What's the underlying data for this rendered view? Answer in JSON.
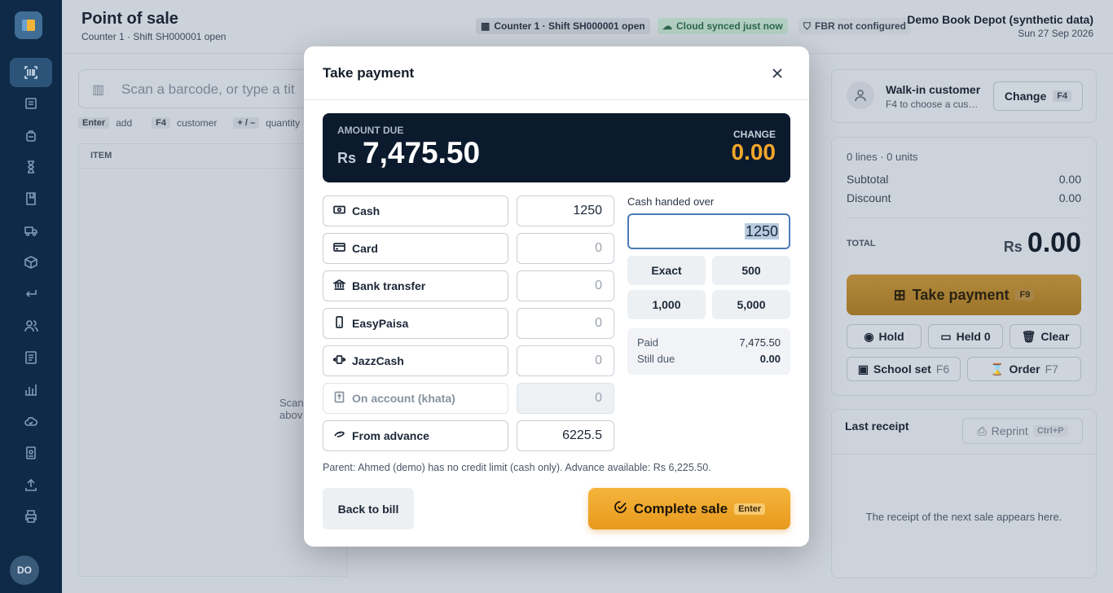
{
  "header": {
    "title": "Point of sale",
    "subtitle": "Counter 1 · Shift SH000001 open",
    "shift_pill": "Counter 1 · Shift SH000001 open",
    "sync_pill": "Cloud synced just now",
    "fbr_pill": "FBR not configured",
    "org": "Demo Book Depot (synthetic data)",
    "date": "Sun 27 Sep 2026"
  },
  "sidebar": {
    "avatar": "DO",
    "icons": [
      "barcode-icon",
      "receipt-icon",
      "school-bag-icon",
      "hourglass-icon",
      "book-icon",
      "truck-icon",
      "box-icon",
      "return-icon",
      "users-icon",
      "ledger-icon",
      "chart-icon",
      "cloud-icon",
      "id-card-icon",
      "upload-icon",
      "printer-icon"
    ]
  },
  "scan": {
    "placeholder": "Scan a barcode, or type a tit",
    "hints": [
      {
        "key": "Enter",
        "label": "add"
      },
      {
        "key": "F4",
        "label": "customer"
      },
      {
        "key": "+ / –",
        "label": "quantity"
      }
    ]
  },
  "items": {
    "column": "ITEM",
    "empty_line1": "Scan",
    "empty_line2": "abov"
  },
  "customer": {
    "name": "Walk-in customer",
    "sub": "F4 to choose a cus…",
    "change_label": "Change",
    "change_key": "F4"
  },
  "totals": {
    "meta": "0 lines · 0 units",
    "subtotal_label": "Subtotal",
    "subtotal": "0.00",
    "discount_label": "Discount",
    "discount": "0.00",
    "total_label": "TOTAL",
    "currency": "Rs",
    "total": "0.00",
    "take_label": "Take payment",
    "take_key": "F9",
    "hold": "Hold",
    "held": "Held 0",
    "clear": "Clear",
    "school_set": "School set",
    "school_set_key": "F6",
    "order": "Order",
    "order_key": "F7"
  },
  "receipt": {
    "title": "Last receipt",
    "reprint": "Reprint",
    "reprint_key": "Ctrl+P",
    "empty": "The receipt of the next sale appears here."
  },
  "modal": {
    "title": "Take payment",
    "amount_due_label": "AMOUNT DUE",
    "currency": "Rs",
    "amount_due": "7,475.50",
    "change_label": "CHANGE",
    "change": "0.00",
    "methods": [
      {
        "label": "Cash",
        "amount": "1250",
        "icon": "cash-icon"
      },
      {
        "label": "Card",
        "amount": "0",
        "icon": "card-icon"
      },
      {
        "label": "Bank transfer",
        "amount": "0",
        "icon": "bank-icon"
      },
      {
        "label": "EasyPaisa",
        "amount": "0",
        "icon": "phone-icon"
      },
      {
        "label": "JazzCash",
        "amount": "0",
        "icon": "jazzcash-icon"
      },
      {
        "label": "On account (khata)",
        "amount": "0",
        "icon": "khata-icon"
      },
      {
        "label": "From advance",
        "amount": "6225.5",
        "icon": "advance-icon"
      }
    ],
    "cash_handed_label": "Cash handed over",
    "cash_handed": "1250",
    "quick": [
      "Exact",
      "500",
      "1,000",
      "5,000"
    ],
    "paid_label": "Paid",
    "paid": "7,475.50",
    "still_due_label": "Still due",
    "still_due": "0.00",
    "note": "Parent: Ahmed (demo) has no credit limit (cash only). Advance available: Rs 6,225.50.",
    "back": "Back to bill",
    "complete": "Complete sale",
    "complete_key": "Enter"
  }
}
